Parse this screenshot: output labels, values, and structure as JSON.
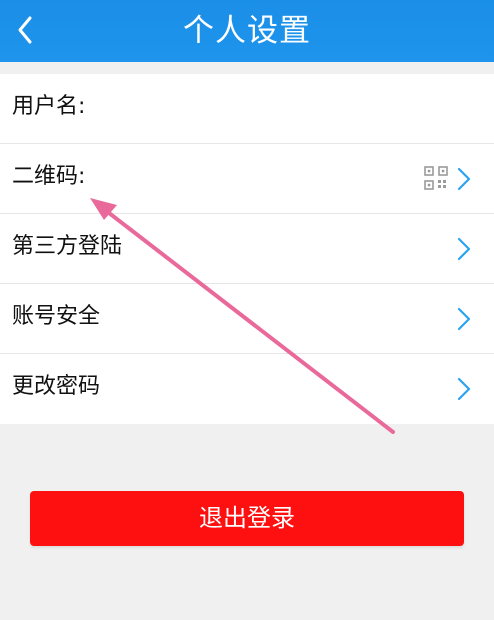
{
  "header": {
    "title": "个人设置",
    "back_icon": "chevron-left-icon"
  },
  "settings": {
    "items": [
      {
        "label": "用户名:"
      },
      {
        "label": "二维码:",
        "icon": "qr-code-icon"
      },
      {
        "label": "第三方登陆"
      },
      {
        "label": "账号安全"
      },
      {
        "label": "更改密码"
      }
    ]
  },
  "logout": {
    "label": "退出登录"
  },
  "colors": {
    "header": "#1E94EC",
    "logout": "#FF1010",
    "chevron": "#2BA3F0",
    "annotation": "#E96A9A"
  }
}
